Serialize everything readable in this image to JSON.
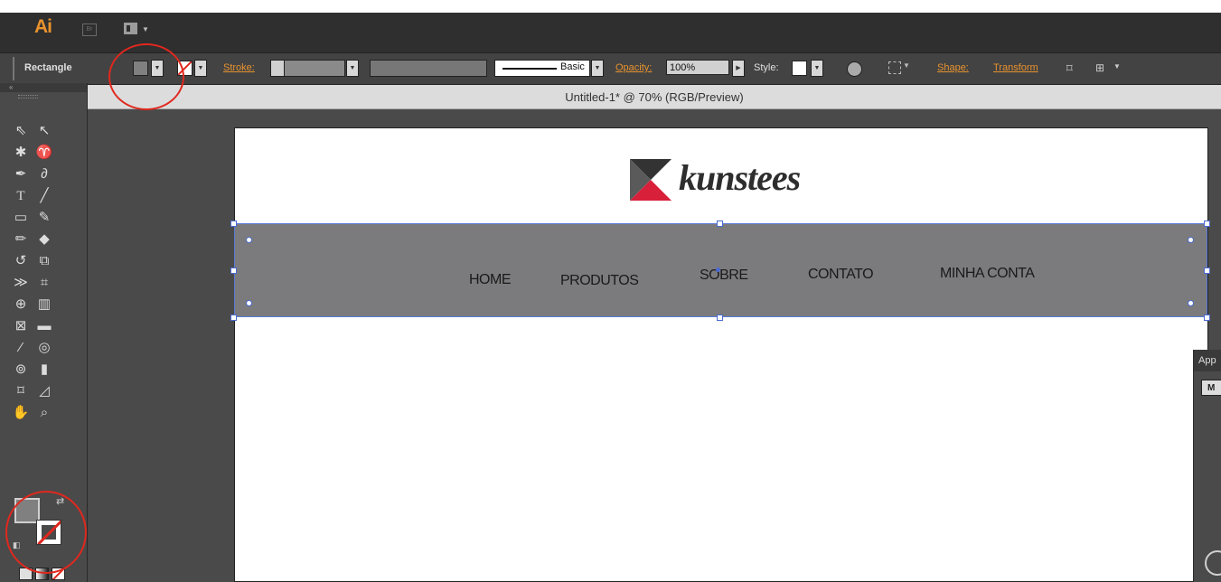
{
  "app": {
    "logo_text": "Ai",
    "bridge_icon": "bridge-icon",
    "workspace_icon": "arrange-documents-icon"
  },
  "controlbar": {
    "tool_name": "Rectangle",
    "fill_color": "#808080",
    "stroke_label": "Stroke:",
    "brush_label": "Basic",
    "opacity_label": "Opacity:",
    "opacity_value": "100%",
    "style_label": "Style:",
    "shape_label": "Shape:",
    "transform_label": "Transform"
  },
  "document": {
    "tab_title": "Untitled-1* @ 70% (RGB/Preview)"
  },
  "artboard": {
    "logo_word": "kunstees",
    "nav_items": [
      "HOME",
      "PRODUTOS",
      "SOBRE",
      "CONTATO",
      "MINHA CONTA"
    ],
    "nav_fill": "#7b7b7d"
  },
  "panel": {
    "title": "App",
    "button_label": "M"
  },
  "toolbar": {
    "collapse_glyph": "«",
    "fill_color": "#808080",
    "stroke_state": "none"
  },
  "colors": {
    "accent_orange": "#e8922e",
    "annotation_red": "#e0281e",
    "selection_blue": "#4a6ad0"
  }
}
